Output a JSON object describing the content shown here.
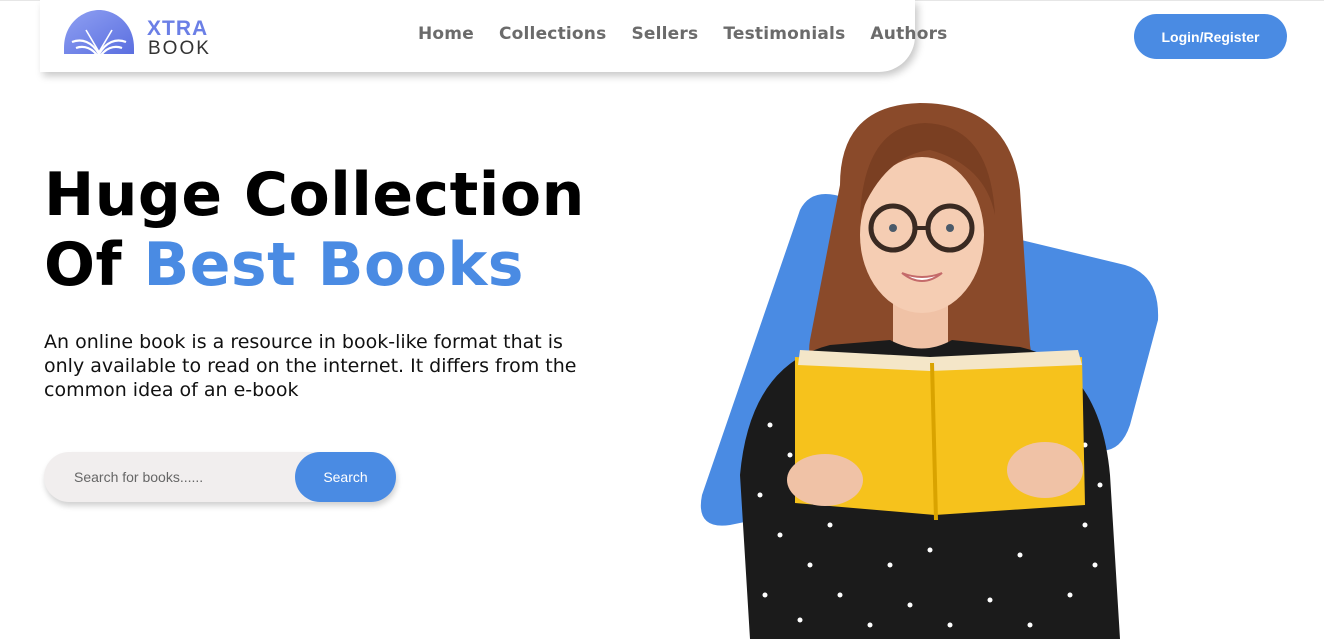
{
  "brand": {
    "line1": "XTRA",
    "line2": "BOOK",
    "colors": {
      "logo_blue": "#6b7fe6",
      "logo_dark": "#333333"
    }
  },
  "nav": {
    "links": [
      "Home",
      "Collections",
      "Sellers",
      "Testimonials",
      "Authors"
    ]
  },
  "auth": {
    "login_label": "Login/Register"
  },
  "hero": {
    "title_line1": "Huge Collection",
    "title_line2_prefix": "Of",
    "title_line2_accent": "Best Books",
    "description": "An online book is a resource in book-like format that is only available to read on the internet. It differs from the common idea of an e-book"
  },
  "search": {
    "placeholder": "Search for books......",
    "value": "",
    "button_label": "Search"
  },
  "colors": {
    "accent": "#4a8be3",
    "nav_text": "#6b6b6b",
    "search_bg": "#f1eeee"
  },
  "image": {
    "icon": "woman-reading-yellow-book-illustration"
  }
}
